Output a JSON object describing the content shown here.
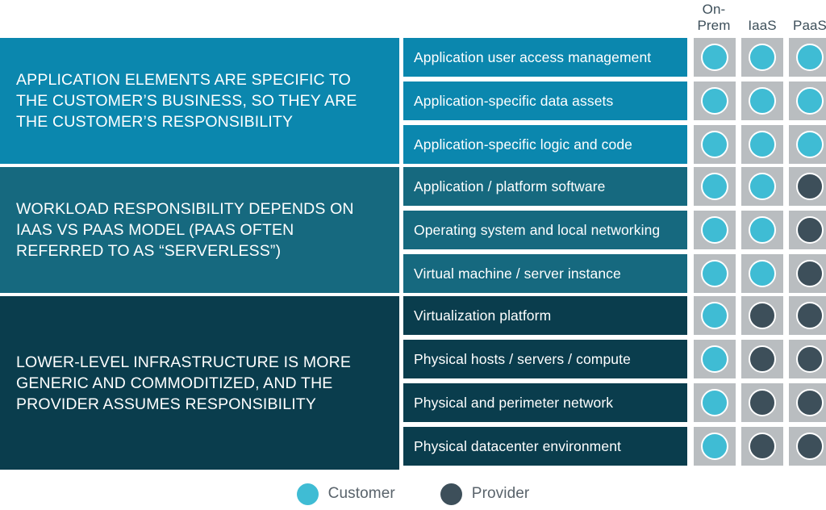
{
  "columns": [
    {
      "id": "on-prem",
      "lines": [
        "On-",
        "Prem"
      ]
    },
    {
      "id": "iaas",
      "lines": [
        "IaaS",
        ""
      ]
    },
    {
      "id": "paas",
      "lines": [
        "PaaS",
        ""
      ]
    }
  ],
  "groups": [
    {
      "id": "application-elements",
      "text": "APPLICATION ELEMENTS ARE SPECIFIC TO THE CUSTOMER’S BUSINESS, SO THEY ARE THE CUSTOMER’S RESPONSIBILITY",
      "color": "#0b87ae"
    },
    {
      "id": "workload-responsibility",
      "text": "WORKLOAD RESPONSIBILITY DEPENDS ON IAAS VS PAAS MODEL (PAAS OFTEN REFERRED TO AS “SERVERLESS”)",
      "color": "#16697f"
    },
    {
      "id": "lower-level-infrastructure",
      "text": "LOWER-LEVEL INFRASTRUCTURE IS MORE GENERIC AND COMMODITIZED, AND THE PROVIDER ASSUMES RESPONSIBILITY",
      "color": "#0a3d4d"
    }
  ],
  "rows": [
    {
      "label": "Application user access management",
      "group": 0,
      "responsibility": [
        "customer",
        "customer",
        "customer"
      ]
    },
    {
      "label": "Application-specific data assets",
      "group": 0,
      "responsibility": [
        "customer",
        "customer",
        "customer"
      ]
    },
    {
      "label": "Application-specific logic and code",
      "group": 0,
      "responsibility": [
        "customer",
        "customer",
        "customer"
      ]
    },
    {
      "label": "Application / platform software",
      "group": 1,
      "responsibility": [
        "customer",
        "customer",
        "provider"
      ]
    },
    {
      "label": "Operating system and local networking",
      "group": 1,
      "responsibility": [
        "customer",
        "customer",
        "provider"
      ]
    },
    {
      "label": "Virtual machine / server instance",
      "group": 1,
      "responsibility": [
        "customer",
        "customer",
        "provider"
      ]
    },
    {
      "label": "Virtualization platform",
      "group": 2,
      "responsibility": [
        "customer",
        "provider",
        "provider"
      ]
    },
    {
      "label": "Physical hosts / servers / compute",
      "group": 2,
      "responsibility": [
        "customer",
        "provider",
        "provider"
      ]
    },
    {
      "label": "Physical and perimeter network",
      "group": 2,
      "responsibility": [
        "customer",
        "provider",
        "provider"
      ]
    },
    {
      "label": "Physical datacenter environment",
      "group": 2,
      "responsibility": [
        "customer",
        "provider",
        "provider"
      ]
    }
  ],
  "legend": [
    {
      "key": "customer",
      "label": "Customer",
      "color": "#3fbcd4"
    },
    {
      "key": "provider",
      "label": "Provider",
      "color": "#3d4f5a"
    }
  ],
  "colors": {
    "customer": "#3fbcd4",
    "provider": "#3d4f5a",
    "cell_background": "#b9bdc0",
    "group_application": "#0b87ae",
    "group_workload": "#16697f",
    "group_infrastructure": "#0a3d4d",
    "header_text": "#3d4f5a",
    "legend_text": "#59636b"
  }
}
